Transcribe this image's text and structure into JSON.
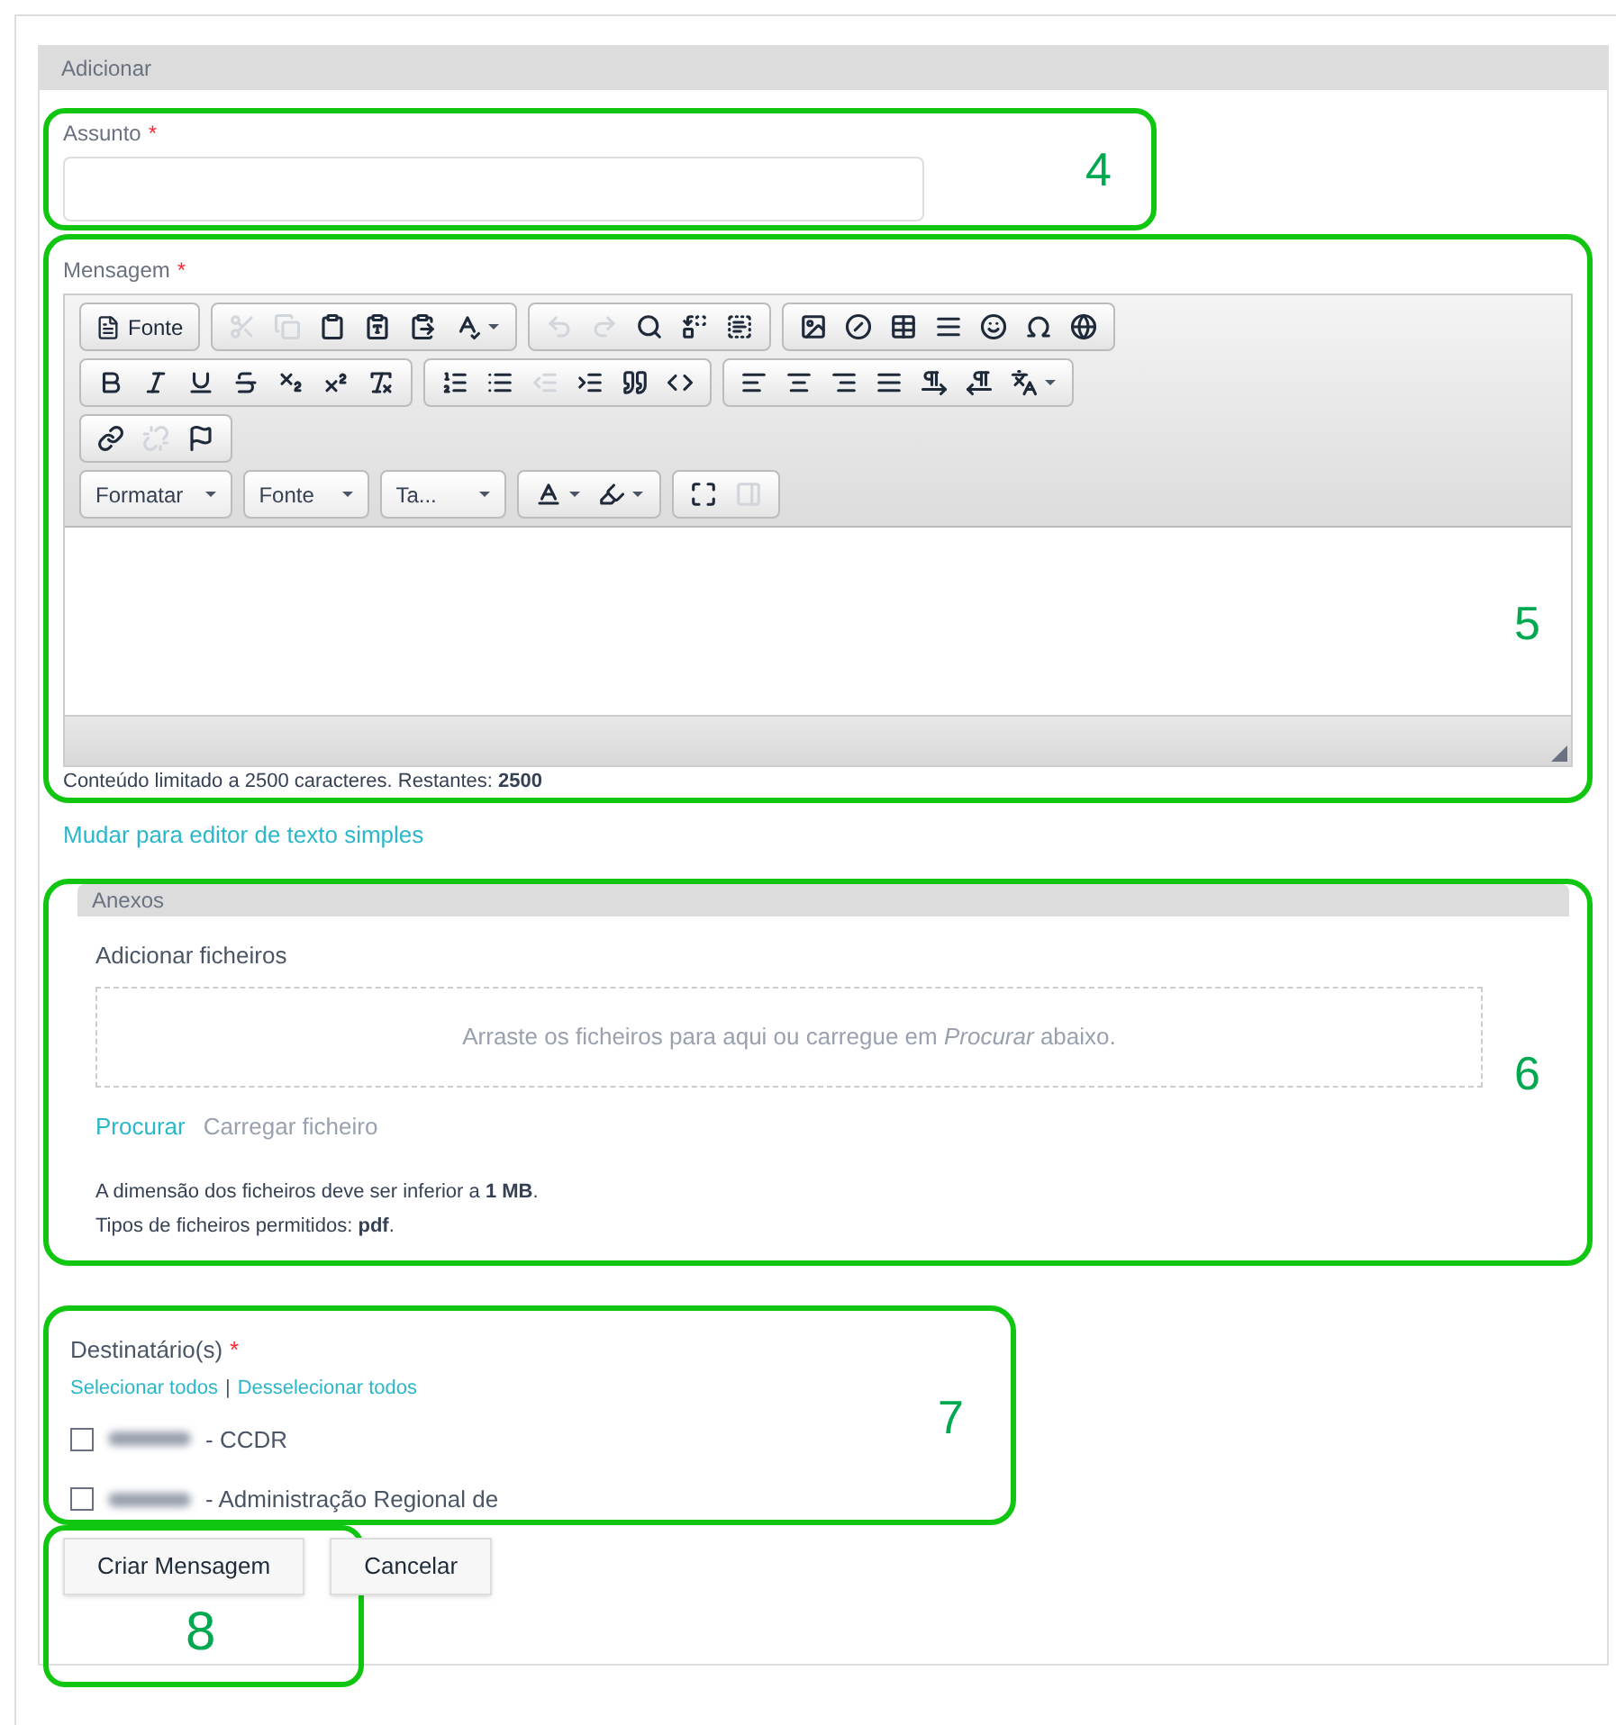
{
  "panel": {
    "title": "Adicionar"
  },
  "subject": {
    "label": "Assunto",
    "required": "*",
    "annotation": "4"
  },
  "message": {
    "label": "Mensagem",
    "required": "*",
    "annotation": "5",
    "toolbar": [
      [
        [
          {
            "kind": "text-icon",
            "label": "Fonte",
            "disabled": false
          }
        ],
        [
          {
            "kind": "icon",
            "disabled": true
          },
          {
            "kind": "icon",
            "disabled": true
          },
          {
            "kind": "icon",
            "disabled": false
          },
          {
            "kind": "icon",
            "disabled": false
          },
          {
            "kind": "icon",
            "disabled": false
          },
          {
            "kind": "icon-menu",
            "disabled": false
          }
        ],
        [
          {
            "kind": "icon",
            "disabled": true
          },
          {
            "kind": "icon",
            "disabled": true
          },
          {
            "kind": "icon",
            "disabled": false
          },
          {
            "kind": "icon",
            "disabled": false
          },
          {
            "kind": "icon",
            "disabled": false
          }
        ],
        [
          {
            "kind": "icon",
            "disabled": false
          },
          {
            "kind": "icon",
            "disabled": false
          },
          {
            "kind": "icon",
            "disabled": false
          },
          {
            "kind": "icon",
            "disabled": false
          },
          {
            "kind": "icon",
            "disabled": false
          },
          {
            "kind": "icon",
            "disabled": false
          },
          {
            "kind": "icon",
            "disabled": false
          }
        ]
      ],
      [
        [
          {
            "kind": "icon",
            "disabled": false
          },
          {
            "kind": "icon",
            "disabled": false
          },
          {
            "kind": "icon",
            "disabled": false
          },
          {
            "kind": "icon",
            "disabled": false
          },
          {
            "kind": "icon",
            "disabled": false
          },
          {
            "kind": "icon",
            "disabled": false
          },
          {
            "kind": "icon",
            "disabled": false
          }
        ],
        [
          {
            "kind": "icon",
            "disabled": false
          },
          {
            "kind": "icon",
            "disabled": false
          },
          {
            "kind": "icon",
            "disabled": true
          },
          {
            "kind": "icon",
            "disabled": false
          },
          {
            "kind": "icon",
            "disabled": false
          },
          {
            "kind": "icon",
            "disabled": false
          }
        ],
        [
          {
            "kind": "icon",
            "disabled": false
          },
          {
            "kind": "icon",
            "disabled": false
          },
          {
            "kind": "icon",
            "disabled": false
          },
          {
            "kind": "icon",
            "disabled": false
          },
          {
            "kind": "icon",
            "disabled": false
          },
          {
            "kind": "icon",
            "disabled": false
          },
          {
            "kind": "icon-menu",
            "disabled": false
          }
        ]
      ],
      [
        [
          {
            "kind": "icon",
            "disabled": false
          },
          {
            "kind": "icon",
            "disabled": true
          },
          {
            "kind": "icon",
            "disabled": false
          }
        ]
      ],
      [
        [
          {
            "kind": "combo",
            "label": "Formatar",
            "disabled": false
          }
        ],
        [
          {
            "kind": "combo",
            "label": "Fonte",
            "disabled": false
          }
        ],
        [
          {
            "kind": "combo",
            "label": "Ta...",
            "disabled": false
          }
        ],
        [
          {
            "kind": "icon-menu",
            "disabled": false
          },
          {
            "kind": "icon-menu",
            "disabled": false
          }
        ],
        [
          {
            "kind": "icon",
            "disabled": false
          },
          {
            "kind": "icon",
            "disabled": true
          }
        ]
      ]
    ],
    "counter": "Conteúdo limitado a 2500 caracteres. Restantes: **2500**"
  },
  "switch_link": "Mudar para editor de texto simples",
  "attachments": {
    "title": "Anexos",
    "annotation": "6",
    "label": "Adicionar ficheiros",
    "dropzone": "Arraste os ficheiros para aqui ou carregue em *Procurar* abaixo.",
    "browse": "Procurar",
    "upload": "Carregar ficheiro",
    "upload_disabled": true,
    "notes": [
      "A dimensão dos ficheiros deve ser inferior a **1 MB**.",
      "Tipos de ficheiros permitidos: **pdf**."
    ]
  },
  "recipients": {
    "label": "Destinatário(s)",
    "required": "*",
    "annotation": "7",
    "select_all": "Selecionar todos",
    "separator": "|",
    "deselect_all": "Desselecionar todos",
    "items": [
      {
        "label": "- CCDR",
        "checked": false
      },
      {
        "label": "- Administração Regional de",
        "checked": false
      }
    ]
  },
  "buttons": [
    {
      "label": "Criar Mensagem"
    },
    {
      "label": "Cancelar"
    }
  ],
  "buttons_annotation": "8"
}
